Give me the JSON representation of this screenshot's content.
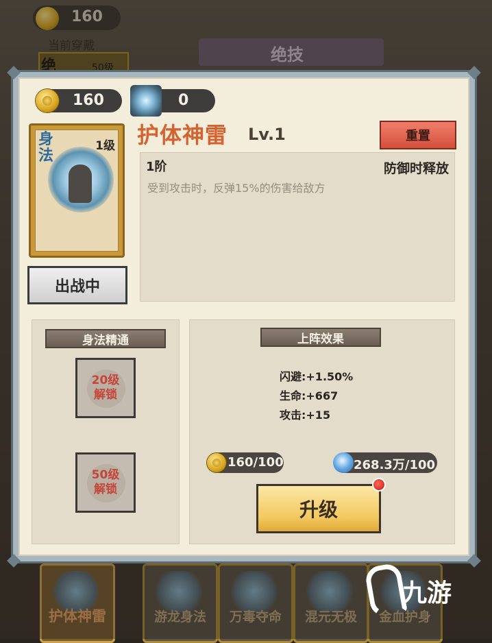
{
  "background": {
    "coins": "160",
    "equipped_label": "当前穿戴",
    "tab_label": "绝技",
    "slot_char": "绝",
    "slot_level": "50级",
    "cards": [
      {
        "name": "护体神雷"
      },
      {
        "name": "游龙身法"
      },
      {
        "name": "万毒夺命"
      },
      {
        "name": "混元无极"
      },
      {
        "name": "金血护身"
      }
    ],
    "watermark": "九游"
  },
  "dialog": {
    "resources": {
      "coins": "160",
      "shards": "0"
    },
    "card": {
      "type": "身法",
      "level": "1级",
      "icon": "lightning-figure-icon"
    },
    "deployed_button": "出战中",
    "skill": {
      "name": "护体神雷",
      "level": "Lv.1"
    },
    "reset_button": "重置",
    "description": {
      "tier": "1阶",
      "trigger": "防御时释放",
      "text": "受到攻击时，反弹15%的伤害给敌方"
    },
    "mastery": {
      "title": "身法精通",
      "locks": [
        {
          "level": "20级",
          "state": "解锁"
        },
        {
          "level": "50级",
          "state": "解锁"
        }
      ]
    },
    "effects": {
      "title": "上阵效果",
      "stats": [
        "闪避:+1.50%",
        "生命:+667",
        "攻击:+15"
      ]
    },
    "costs": {
      "coins": "160/100",
      "orbs": "268.3万/100"
    },
    "upgrade_button": "升级",
    "colors": {
      "title": "#d5632f",
      "lock_text": "#c5453a",
      "reset": "#d4503c",
      "upgrade": "#f3c85e"
    }
  }
}
